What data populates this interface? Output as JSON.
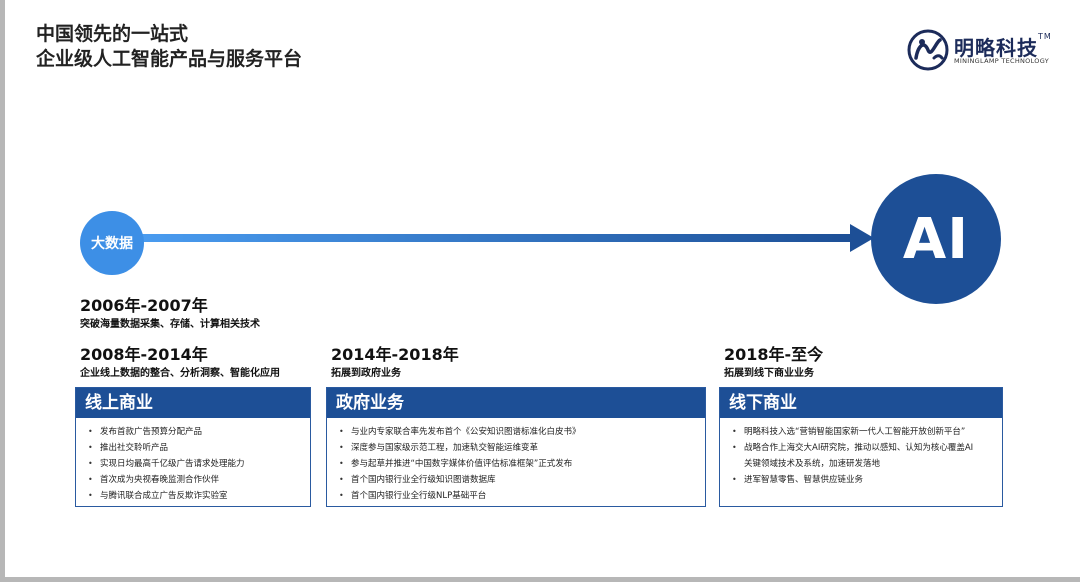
{
  "title": {
    "line1": "中国领先的一站式",
    "line2": "企业级人工智能产品与服务平台"
  },
  "logo": {
    "name": "明略科技",
    "tm": "TM",
    "sub": "MININGLAMP TECHNOLOGY"
  },
  "timeline": {
    "start_label": "大数据",
    "end_label": "AI"
  },
  "periods": [
    {
      "years": "2006年-2007年",
      "desc": "突破海量数据采集、存储、计算相关技术"
    },
    {
      "years": "2008年-2014年",
      "desc": "企业线上数据的整合、分析洞察、智能化应用"
    },
    {
      "years": "2014年-2018年",
      "desc": "拓展到政府业务"
    },
    {
      "years": "2018年-至今",
      "desc": "拓展到线下商业业务"
    }
  ],
  "panels": [
    {
      "title": "线上商业",
      "items": [
        "发布首款广告预算分配产品",
        "推出社交聆听产品",
        "实现日均最高千亿级广告请求处理能力",
        "首次成为央视春晚监测合作伙伴",
        "与腾讯联合成立广告反欺诈实验室"
      ]
    },
    {
      "title": "政府业务",
      "items": [
        "与业内专家联合率先发布首个《公安知识图谱标准化白皮书》",
        "深度参与国家级示范工程，加速轨交智能运维变革",
        "参与起草并推进“中国数字媒体价值评估标准框架”正式发布",
        "首个国内银行业全行级知识图谱数据库",
        "首个国内银行业全行级NLP基础平台"
      ]
    },
    {
      "title": "线下商业",
      "items": [
        "明略科技入选“营销智能国家新一代人工智能开放创新平台”",
        "战略合作上海交大AI研究院，推动以感知、认知为核心覆盖AI",
        "关键领域技术及系统，加速研发落地",
        "进军智慧零售、智慧供应链业务"
      ]
    }
  ],
  "colors": {
    "accent_dark": "#1d4f96",
    "accent_light": "#3d8fe6"
  }
}
